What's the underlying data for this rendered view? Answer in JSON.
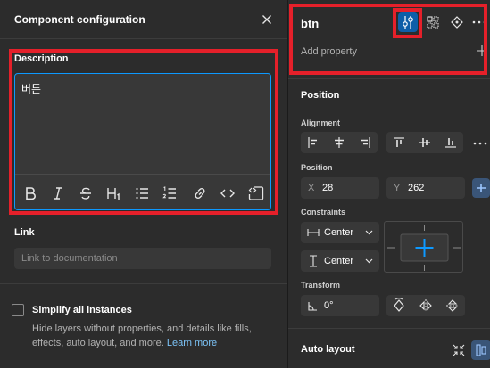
{
  "dialog": {
    "title": "Component configuration",
    "description_label": "Description",
    "description_text": "버튼",
    "toolbar": [
      "bold-icon",
      "italic-icon",
      "strikethrough-icon",
      "heading-icon",
      "bulleted-list-icon",
      "numbered-list-icon",
      "link-icon",
      "code-icon",
      "code-block-icon"
    ],
    "link_label": "Link",
    "link_placeholder": "Link to documentation",
    "simplify_label": "Simplify all instances",
    "simplify_help": "Hide layers without properties, and details like fills, effects, auto layout, and more.",
    "learn_more": "Learn more"
  },
  "panel": {
    "layer_name": "btn",
    "header_icons": [
      "component-properties-icon",
      "instance-grid-icon",
      "variant-diamond-icon",
      "more-icon"
    ],
    "add_property": "Add property",
    "position": {
      "title": "Position",
      "alignment_label": "Alignment",
      "position_label": "Position",
      "x_prefix": "X",
      "x_value": "28",
      "y_prefix": "Y",
      "y_value": "262",
      "constraints_label": "Constraints",
      "constraint_h": "Center",
      "constraint_v": "Center",
      "transform_label": "Transform",
      "rotation": "0°"
    },
    "auto_layout_title": "Auto layout"
  },
  "colors": {
    "accent": "#0d99ff",
    "annotation": "#e5202a",
    "panel_bg": "#2c2c2c",
    "field_bg": "#383838"
  }
}
